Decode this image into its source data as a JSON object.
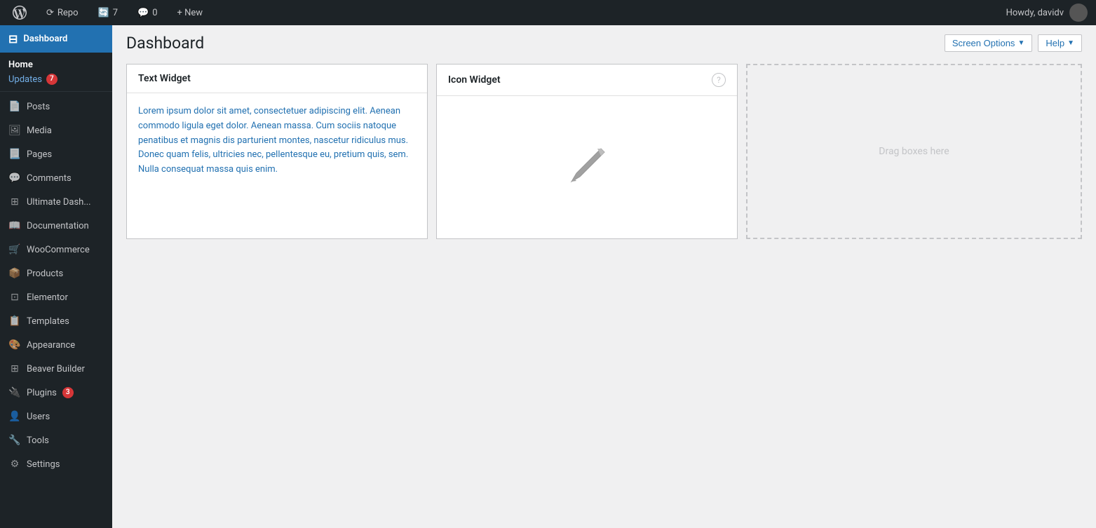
{
  "adminBar": {
    "wpLogo": "wp-logo",
    "repoLabel": "Repo",
    "updatesCount": "7",
    "commentsCount": "0",
    "newLabel": "+ New",
    "howdy": "Howdy, davidv"
  },
  "sidebar": {
    "dashboardLabel": "Dashboard",
    "homeLabel": "Home",
    "updatesLabel": "Updates",
    "updatesBadge": "7",
    "items": [
      {
        "id": "posts",
        "label": "Posts",
        "icon": "📄"
      },
      {
        "id": "media",
        "label": "Media",
        "icon": "🖼"
      },
      {
        "id": "pages",
        "label": "Pages",
        "icon": "📃"
      },
      {
        "id": "comments",
        "label": "Comments",
        "icon": "💬"
      },
      {
        "id": "ultimate-dash",
        "label": "Ultimate Dash...",
        "icon": "⊞"
      },
      {
        "id": "documentation",
        "label": "Documentation",
        "icon": "📖"
      },
      {
        "id": "woocommerce",
        "label": "WooCommerce",
        "icon": "🛒"
      },
      {
        "id": "products",
        "label": "Products",
        "icon": "📦"
      },
      {
        "id": "elementor",
        "label": "Elementor",
        "icon": "⊡"
      },
      {
        "id": "templates",
        "label": "Templates",
        "icon": "📋"
      },
      {
        "id": "appearance",
        "label": "Appearance",
        "icon": "🎨"
      },
      {
        "id": "beaver-builder",
        "label": "Beaver Builder",
        "icon": "⊞"
      },
      {
        "id": "plugins",
        "label": "Plugins",
        "icon": "🔌",
        "badge": "3"
      },
      {
        "id": "users",
        "label": "Users",
        "icon": "👤"
      },
      {
        "id": "tools",
        "label": "Tools",
        "icon": "🔧"
      },
      {
        "id": "settings",
        "label": "Settings",
        "icon": "⚙"
      }
    ]
  },
  "header": {
    "pageTitle": "Dashboard",
    "screenOptionsLabel": "Screen Options",
    "helpLabel": "Help"
  },
  "widgets": {
    "textWidget": {
      "title": "Text Widget",
      "content": "Lorem ipsum dolor sit amet, consectetuer adipiscing elit. Aenean commodo ligula eget dolor. Aenean massa. Cum sociis natoque penatibus et magnis dis parturient montes, nascetur ridiculus mus. Donec quam felis, ultricies nec, pellentesque eu, pretium quis, sem. Nulla consequat massa quis enim."
    },
    "iconWidget": {
      "title": "Icon Widget",
      "helpTooltip": "?"
    },
    "dragBox": {
      "label": "Drag boxes here"
    }
  }
}
